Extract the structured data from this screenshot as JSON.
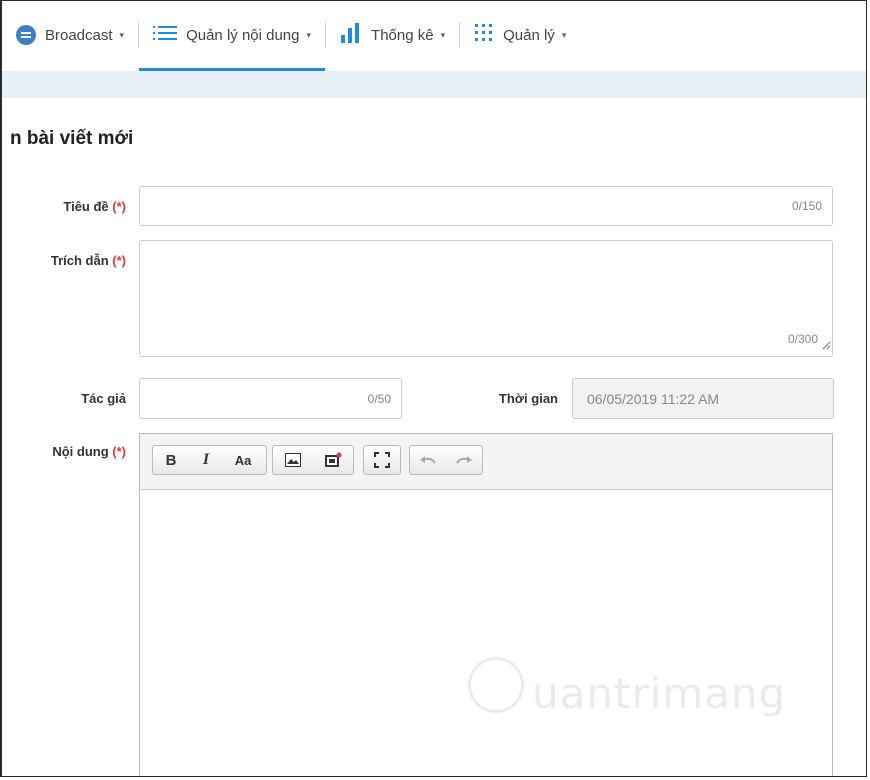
{
  "nav": {
    "broadcast": {
      "label": "Broadcast",
      "icon": "chat-bubble-icon"
    },
    "content": {
      "label": "Quản lý nội dung",
      "icon": "list-icon"
    },
    "stats": {
      "label": "Thống kê",
      "icon": "bar-chart-icon"
    },
    "manage": {
      "label": "Quản lý",
      "icon": "grid-icon"
    },
    "caret": "▾",
    "active_color": "#1a8ee1"
  },
  "page": {
    "title": "n bài viết mới"
  },
  "form": {
    "required_mark": "(*)",
    "title": {
      "label": "Tiêu đề",
      "counter": "0/150",
      "value": ""
    },
    "quote": {
      "label": "Trích dẫn",
      "counter": "0/300",
      "value": ""
    },
    "author": {
      "label": "Tác giả",
      "counter": "0/50",
      "value": ""
    },
    "time": {
      "label": "Thời gian",
      "value": "06/05/2019 11:22 AM"
    },
    "content": {
      "label": "Nội dung"
    }
  },
  "toolbar": {
    "bold": "B",
    "italic": "I",
    "font_size": "Aa"
  },
  "watermark": {
    "text": "uantrimang",
    "brand": "Quantrimang"
  }
}
